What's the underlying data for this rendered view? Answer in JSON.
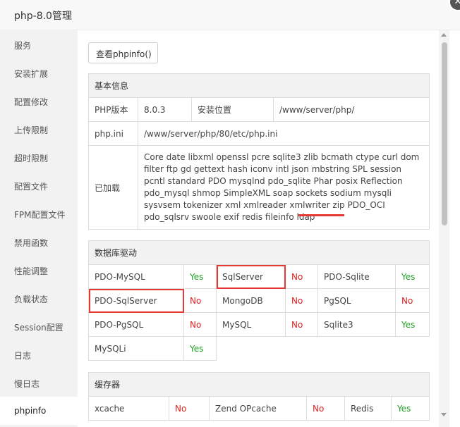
{
  "window": {
    "title": "php-8.0管理",
    "close_glyph": "✕"
  },
  "sidebar": {
    "items": [
      {
        "label": "服务"
      },
      {
        "label": "安装扩展"
      },
      {
        "label": "配置修改"
      },
      {
        "label": "上传限制"
      },
      {
        "label": "超时限制"
      },
      {
        "label": "配置文件"
      },
      {
        "label": "FPM配置文件"
      },
      {
        "label": "禁用函数"
      },
      {
        "label": "性能调整"
      },
      {
        "label": "负载状态"
      },
      {
        "label": "Session配置"
      },
      {
        "label": "日志"
      },
      {
        "label": "慢日志"
      },
      {
        "label": "phpinfo"
      }
    ],
    "active": "phpinfo"
  },
  "main": {
    "phpinfo_button": "查看phpinfo()",
    "basic": {
      "header": "基本信息",
      "php_version_label": "PHP版本",
      "php_version": "8.0.3",
      "install_location_label": "安装位置",
      "install_location": "/www/server/php/",
      "phpini_label": "php.ini",
      "phpini_path": "/www/server/php/80/etc/php.ini",
      "loaded_label": "已加载",
      "loaded_before": "Core date libxml openssl pcre sqlite3 zlib bcmath ctype curl dom filter ftp gd gettext hash iconv intl json mbstring SPL session pcntl standard PDO mysqlnd pdo_sqlite Phar posix Reflection pdo_mysql shmop SimpleXML soap sockets sodium mysqli sysvsem tokenizer xml xmlreader xmlwriter zip PDO_OCI ",
      "loaded_highlight": "pdo_sqlsrv",
      "loaded_after": " swoole exif redis fileinfo ldap"
    },
    "db": {
      "header": "数据库驱动",
      "rows": [
        [
          {
            "name": "PDO-MySQL",
            "status": "Yes"
          },
          {
            "name": "SqlServer",
            "status": "No"
          },
          {
            "name": "PDO-Sqlite",
            "status": "Yes"
          }
        ],
        [
          {
            "name": "PDO-SqlServer",
            "status": "No"
          },
          {
            "name": "MongoDB",
            "status": "No"
          },
          {
            "name": "PgSQL",
            "status": "No"
          }
        ],
        [
          {
            "name": "PDO-PgSQL",
            "status": "No"
          },
          {
            "name": "MySQL",
            "status": "No"
          },
          {
            "name": "Sqlite3",
            "status": "Yes"
          }
        ],
        [
          {
            "name": "MySQLi",
            "status": "Yes"
          }
        ]
      ]
    },
    "cache": {
      "header": "缓存器",
      "items": [
        {
          "name": "xcache",
          "status": "No"
        },
        {
          "name": "Zend OPcache",
          "status": "No"
        },
        {
          "name": "Redis",
          "status": "Yes"
        }
      ]
    }
  }
}
